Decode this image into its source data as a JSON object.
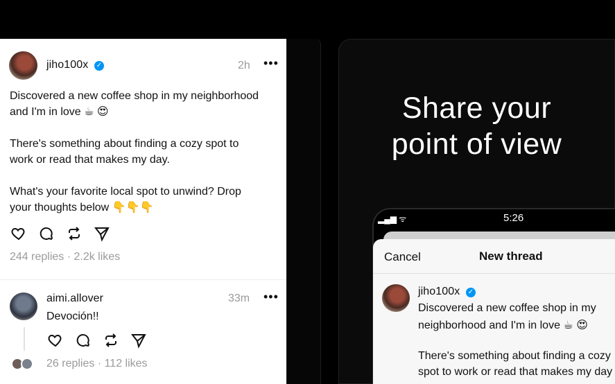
{
  "posts": [
    {
      "username": "jiho100x",
      "verified": true,
      "time": "2h",
      "more": "•••",
      "lines": [
        "Discovered a new coffee shop in my neighborhood",
        "and I'm in love ☕ 😍",
        "There's something about finding a cozy spot to",
        "work or read that makes my day.",
        "What's your favorite local spot to unwind? Drop",
        "your thoughts below 👇👇👇"
      ],
      "stats": "244 replies · 2.2k likes"
    },
    {
      "username": "aimi.allover",
      "time": "33m",
      "more": "•••",
      "text": "Devoción!!",
      "stats": "26 replies · 112 likes"
    }
  ],
  "actions": [
    "heart-icon",
    "comment-icon",
    "repost-icon",
    "send-icon"
  ],
  "promo": {
    "headline_line1": "Share your",
    "headline_line2": "point of view"
  },
  "phone": {
    "status_icons": "▂▄▆ ᯤ",
    "time": "5:26",
    "cancel_label": "Cancel",
    "title": "New thread",
    "composer": {
      "username": "jiho100x",
      "verified": true,
      "lines": [
        "Discovered a new coffee shop in my",
        "neighborhood and I'm in love ☕ 😍",
        "There's something about finding a cozy",
        "spot to work or read that makes my day"
      ]
    }
  },
  "colors": {
    "background": "#000000",
    "card": "#ffffff",
    "muted_text": "#9a9a9a",
    "verified_blue": "#0095f6"
  }
}
